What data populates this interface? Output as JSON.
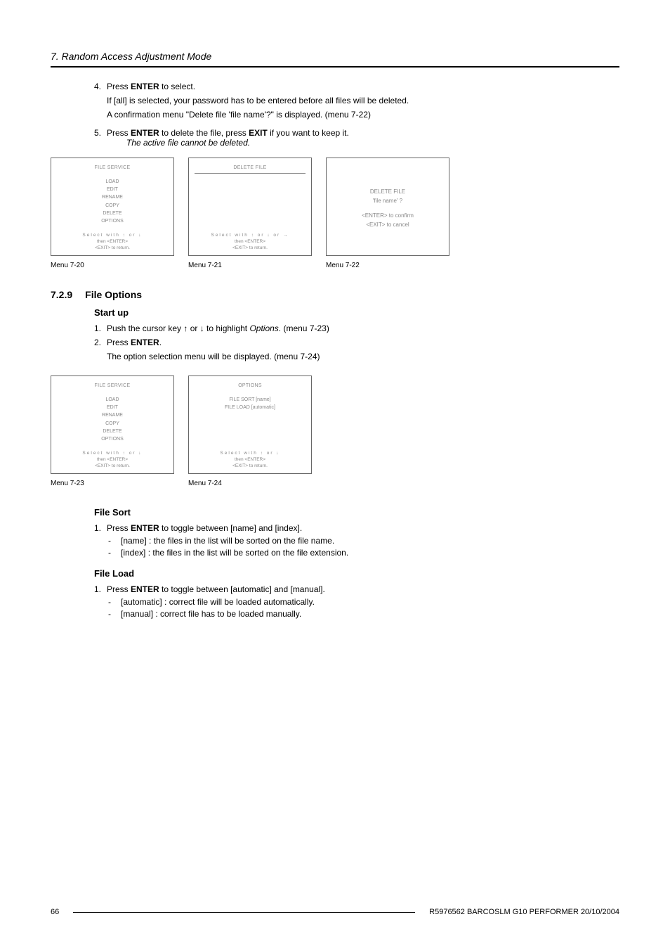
{
  "header": {
    "chapter_title": "7. Random Access Adjustment Mode"
  },
  "steps_a": {
    "s4_num": "4.",
    "s4_text_a": "Press ",
    "s4_text_b": "ENTER",
    "s4_text_c": " to select.",
    "s4_sub1": "If [all] is selected, your password has to be entered before all files will be deleted.",
    "s4_sub2": "A confirmation menu \"Delete file 'file name'?\" is displayed. (menu 7-22)",
    "s5_num": "5.",
    "s5_text_a": "Press ",
    "s5_text_b": "ENTER",
    "s5_text_c": " to delete the file, press ",
    "s5_text_d": "EXIT",
    "s5_text_e": " if you want to keep it.",
    "s5_note": "The active file cannot be deleted."
  },
  "menu20": {
    "title": "FILE SERVICE",
    "items": [
      "LOAD",
      "EDIT",
      "RENAME",
      "COPY",
      "DELETE",
      "OPTIONS"
    ],
    "sel_index": 4,
    "hint1": "Select with ↑ or ↓",
    "hint2": "then <ENTER>",
    "hint3": "<EXIT> to return.",
    "caption": "Menu 7-20"
  },
  "menu21": {
    "title": "DELETE FILE",
    "hint1": "Select with ↑ or ↓ or →",
    "hint2": "then <ENTER>",
    "hint3": "<EXIT> to return.",
    "caption": "Menu 7-21"
  },
  "menu22": {
    "line1": "DELETE FILE",
    "line2": "'file name' ?",
    "line3": "<ENTER> to confirm",
    "line4": "<EXIT> to cancel",
    "caption": "Menu 7-22"
  },
  "section729": {
    "num": "7.2.9",
    "title": "File Options"
  },
  "startup": {
    "heading": "Start up",
    "s1_num": "1.",
    "s1_a": "Push the cursor key ↑ or ↓ to highlight ",
    "s1_b": "Options",
    "s1_c": ". (menu 7-23)",
    "s2_num": "2.",
    "s2_a": "Press ",
    "s2_b": "ENTER",
    "s2_c": ".",
    "s2_sub": "The option selection menu will be displayed. (menu 7-24)"
  },
  "menu23": {
    "title": "FILE SERVICE",
    "items": [
      "LOAD",
      "EDIT",
      "RENAME",
      "COPY",
      "DELETE",
      "OPTIONS"
    ],
    "sel_index": 5,
    "hint1": "Select with ↑ or ↓",
    "hint2": "then <ENTER>",
    "hint3": "<EXIT> to return.",
    "caption": "Menu 7-23"
  },
  "menu24": {
    "title": "OPTIONS",
    "items": [
      "FILE SORT [name]",
      "FILE LOAD [automatic]"
    ],
    "hint1": "Select with ↑ or ↓",
    "hint2": "then <ENTER>",
    "hint3": "<EXIT> to return.",
    "caption": "Menu 7-24"
  },
  "filesort": {
    "heading": "File Sort",
    "s1_num": "1.",
    "s1_a": "Press ",
    "s1_b": "ENTER",
    "s1_c": " to toggle between [name] and [index].",
    "b1": "[name] : the files in the list will be sorted on the file name.",
    "b2": "[index] : the files in the list will be sorted on the file extension."
  },
  "fileload": {
    "heading": "File Load",
    "s1_num": "1.",
    "s1_a": "Press ",
    "s1_b": "ENTER",
    "s1_c": " to toggle between [automatic] and [manual].",
    "b1": "[automatic] : correct file will be loaded automatically.",
    "b2": "[manual] : correct file has to be loaded manually."
  },
  "footer": {
    "page": "66",
    "doc": "R5976562  BARCOSLM G10 PERFORMER  20/10/2004"
  }
}
